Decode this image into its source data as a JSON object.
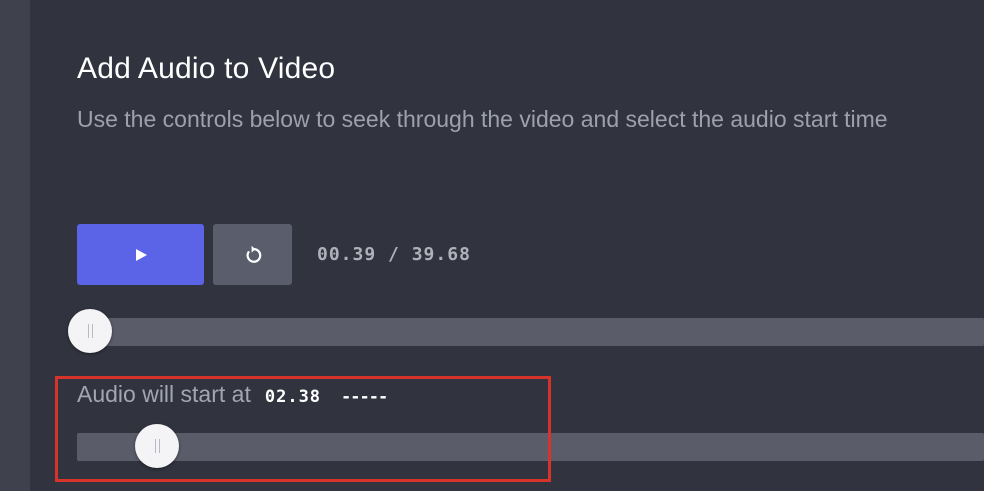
{
  "page": {
    "title": "Add Audio to Video",
    "subtitle": "Use the controls below to seek through the video and select the audio start time"
  },
  "controls": {
    "play_icon": "play-icon",
    "restart_icon": "restart-icon",
    "current_time": "00.39",
    "separator": "/",
    "duration": "39.68"
  },
  "video_seek": {
    "value": 0.39,
    "max": 39.68
  },
  "audio_start": {
    "label": "Audio will start at",
    "value_text": "02.38",
    "dashes": "-----",
    "value": 2.38,
    "max": 39.68
  },
  "colors": {
    "background": "#31343f",
    "accent": "#5b63e6",
    "secondary_button": "#5a5e6c",
    "track": "#5a5d69",
    "highlight": "#d6342b"
  }
}
